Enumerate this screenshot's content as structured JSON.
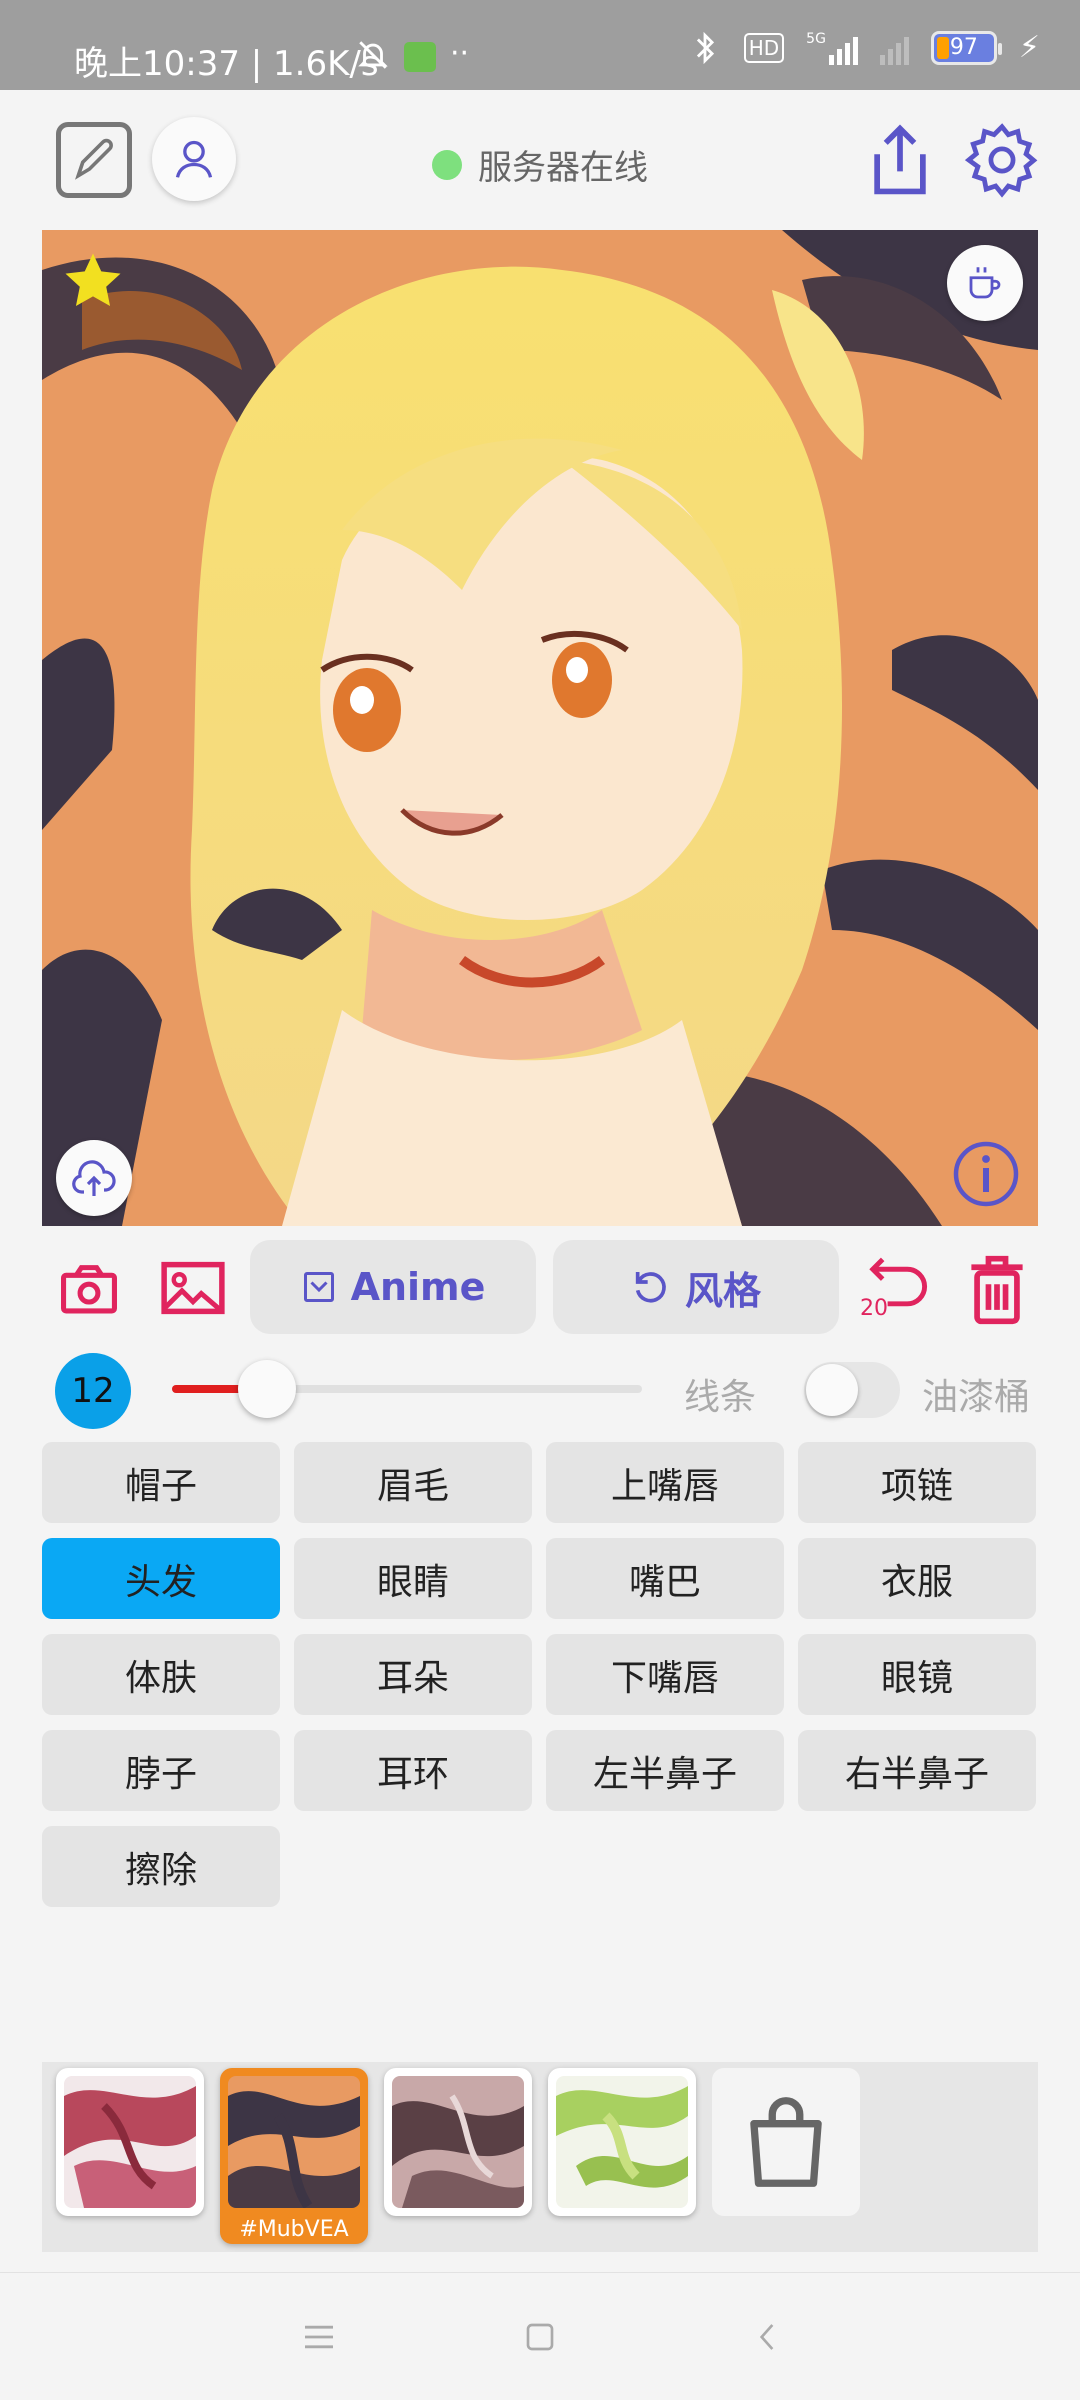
{
  "status_bar": {
    "left_text": "晚上10:37 | 1.6K/s",
    "battery": "97",
    "network": "5G",
    "hd": "HD"
  },
  "header": {
    "server_status": "服务器在线"
  },
  "toolbar": {
    "model_label": "Anime",
    "style_label": "风格",
    "undo_count": "20"
  },
  "brush": {
    "size": "12",
    "slider_fraction": 0.12,
    "line_label": "线条",
    "bucket_label": "油漆桶",
    "bucket_enabled": false
  },
  "parts": [
    {
      "label": "帽子",
      "active": false
    },
    {
      "label": "眉毛",
      "active": false
    },
    {
      "label": "上嘴唇",
      "active": false
    },
    {
      "label": "项链",
      "active": false
    },
    {
      "label": "头发",
      "active": true
    },
    {
      "label": "眼睛",
      "active": false
    },
    {
      "label": "嘴巴",
      "active": false
    },
    {
      "label": "衣服",
      "active": false
    },
    {
      "label": "体肤",
      "active": false
    },
    {
      "label": "耳朵",
      "active": false
    },
    {
      "label": "下嘴唇",
      "active": false
    },
    {
      "label": "眼镜",
      "active": false
    },
    {
      "label": "脖子",
      "active": false
    },
    {
      "label": "耳环",
      "active": false
    },
    {
      "label": "左半鼻子",
      "active": false
    },
    {
      "label": "右半鼻子",
      "active": false
    },
    {
      "label": "擦除",
      "active": false
    }
  ],
  "styles": {
    "selected_label": "#MubVEA"
  },
  "colors": {
    "accent": "#5a55c8",
    "danger": "#e0245e",
    "active_part": "#0aa8f4",
    "online": "#7ee07e",
    "star": "#f2e020"
  }
}
